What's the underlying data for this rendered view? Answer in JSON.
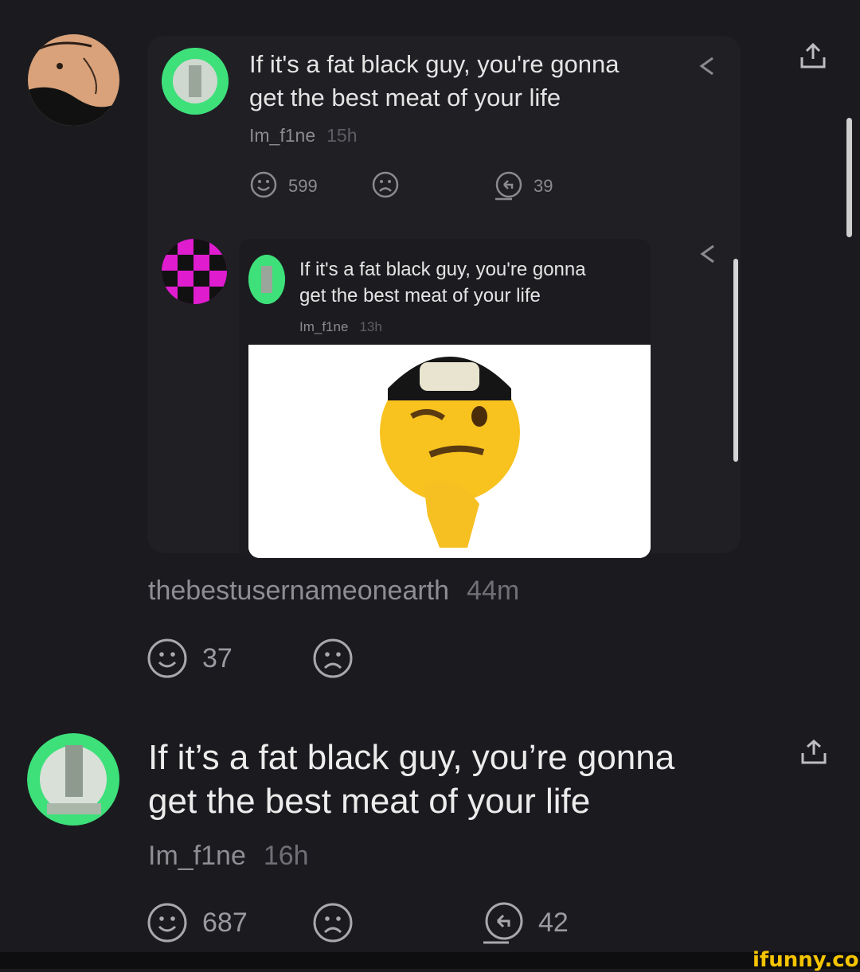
{
  "top_post": {
    "text_line1": "If it's a fat black guy, you're gonna",
    "text_line2": "get the best meat of your life",
    "username": "Im_f1ne",
    "time": "15h",
    "smile_count": "599",
    "reply_count": "39"
  },
  "nested_post": {
    "text_line1": "If it's a fat black guy, you're gonna",
    "text_line2": "get the best meat of your life",
    "username": "Im_f1ne",
    "time": "13h"
  },
  "comment": {
    "username": "thebestusernameonearth",
    "time": "44m",
    "smile_count": "37"
  },
  "bottom_post": {
    "text_line1": "If it’s a fat black guy, you’re gonna",
    "text_line2": "get the best meat of your life",
    "username": "Im_f1ne",
    "time": "16h",
    "smile_count": "687",
    "reply_count": "42"
  },
  "watermark": "ifunny.co",
  "colors": {
    "background": "#1b1b1f",
    "watermark": "#f5c400",
    "avatar_green": "#3ee07a",
    "avatar_magenta": "#e01ccf"
  }
}
